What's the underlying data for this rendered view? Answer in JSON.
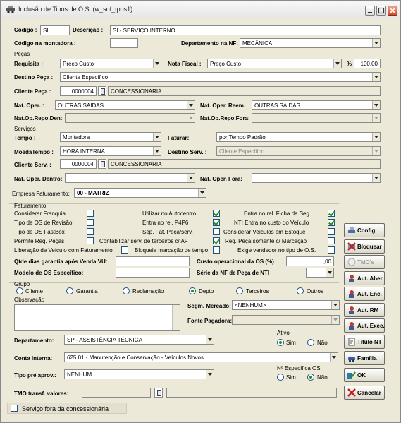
{
  "window": {
    "title": "Inclusão de Tipos de O.S. (w_sof_tpos1)"
  },
  "header": {
    "codigo_label": "Código :",
    "codigo_value": "SI",
    "descricao_label": "Descrição :",
    "descricao_value": "SI - SERVIÇO INTERNO",
    "codigo_montadora_label": "Código na montadora :",
    "codigo_montadora_value": "",
    "departamento_nf_label": "Departamento na NF:",
    "departamento_nf_value": "MECÂNICA"
  },
  "pecas": {
    "section_label": "Peças",
    "requisita_label": "Requisita :",
    "requisita_value": "Preço Custo",
    "nota_fiscal_label": "Nota Fiscal :",
    "nota_fiscal_value": "Preço Custo",
    "percent_label": "%",
    "percent_value": "100,00",
    "destino_label": "Destino Peça :",
    "destino_value": "Cliente Específico",
    "cliente_label": "Cliente Peça :",
    "cliente_code": "0000004",
    "cliente_name": "CONCESSIONARIA",
    "nat_oper_label": "Nat. Oper. :",
    "nat_oper_value": "OUTRAS SAIDAS",
    "nat_oper_reem_label": "Nat. Oper. Reem.",
    "nat_oper_reem_value": "OUTRAS SAIDAS",
    "nat_repo_den_label": "Nat.Op.Repo.Den:",
    "nat_repo_den_value": "",
    "nat_repo_fora_label": "Nat.Op.Repo.Fora:",
    "nat_repo_fora_value": ""
  },
  "servicos": {
    "section_label": "Serviços",
    "tempo_label": "Tempo :",
    "tempo_value": "Montadora",
    "faturar_label": "Faturar:",
    "faturar_value": "por Tempo Padrão",
    "moeda_label": "MoedaTempo :",
    "moeda_value": "HORA  INTERNA",
    "destino_label": "Destino Serv. :",
    "destino_value": "Cliente Específico",
    "cliente_label": "Cliente Serv. :",
    "cliente_code": "0000004",
    "cliente_name": "CONCESSIONARIA",
    "nat_dentro_label": "Nat. Oper. Dentro:",
    "nat_dentro_value": "",
    "nat_fora_label": "Nat. Oper. Fora:",
    "nat_fora_value": ""
  },
  "empresa": {
    "label": "Empresa Faturamento:",
    "value": "00 - MATRIZ"
  },
  "faturamento": {
    "section_label": "Faturamento",
    "checks": [
      {
        "label": "Considerar Franquia",
        "checked": false
      },
      {
        "label": "Tipo de OS de Revisão",
        "checked": false
      },
      {
        "label": "Tipo de OS FastBox",
        "checked": false
      },
      {
        "label": "Permite Req. Peças",
        "checked": false
      },
      {
        "label": "Liberação de Veículo com Faturamento",
        "checked": false
      },
      {
        "label": "Utilizar no Autocentro",
        "checked": true
      },
      {
        "label": "Entra no rel. P4P6",
        "checked": true
      },
      {
        "label": "Sep. Fat. Peça/serv.",
        "checked": false
      },
      {
        "label": "Contabilizar serv. de terceiros c/ AF",
        "checked": true
      },
      {
        "label": "Bloqueia marcação de tempo",
        "checked": false
      },
      {
        "label": "Entra no rel. Ficha de Seg.",
        "checked": true
      },
      {
        "label": "NTI Entra no custo do Veículo",
        "checked": true
      },
      {
        "label": "Considerar Veículos em Estoque",
        "checked": false
      },
      {
        "label": "Req. Peça somente c/ Marcação",
        "checked": false
      },
      {
        "label": "Exige vendedor no tipo de O.S.",
        "checked": false
      }
    ],
    "qtde_label": "Qtde dias garantia após Venda VU:",
    "qtde_value": "",
    "custo_label": "Custo operacional da OS (%)",
    "custo_value": ",00",
    "modelo_label": "Modelo de OS Específico:",
    "modelo_value": "",
    "serie_label": "Série da NF de Peça de NTI",
    "serie_value": ""
  },
  "grupo": {
    "section_label": "Grupo",
    "options": [
      {
        "label": "Cliente",
        "selected": false
      },
      {
        "label": "Garantia",
        "selected": false
      },
      {
        "label": "Reclamação",
        "selected": false
      },
      {
        "label": "Depto",
        "selected": true
      },
      {
        "label": "Terceiros",
        "selected": false
      },
      {
        "label": "Outros",
        "selected": false
      }
    ],
    "observacao_label": "Observação",
    "segm_label": "Segm. Mercado:",
    "segm_value": "<NENHUM>",
    "fonte_label": "Fonte Pagadora:",
    "fonte_value": ""
  },
  "bottom": {
    "departamento_label": "Departamento:",
    "departamento_value": "SP - ASSISTÊNCIA TÉCNICA",
    "ativo_label": "Ativo",
    "ativo_sim": "Sim",
    "ativo_nao": "Não",
    "conta_label": "Conta Interna:",
    "conta_value": "625.01 - Manutenção e Conservação - Veículos Novos",
    "tipo_pre_label": "Tipo pré aprov.:",
    "tipo_pre_value": "NENHUM",
    "nespecifica_label": "Nº Específica OS",
    "nespecifica_sim": "Sim",
    "nespecifica_nao": "Não",
    "tmo_label": "TMO transf. valores:",
    "tmo_value": "",
    "tmo_name": "",
    "servico_fora_label": "Serviço fora da concessionária"
  },
  "buttons": [
    {
      "label": "Config.",
      "icon": "tools-icon",
      "enabled": true
    },
    {
      "label": "Bloquear",
      "icon": "block-icon",
      "enabled": true
    },
    {
      "label": "TMO's",
      "icon": "clock-icon",
      "enabled": false
    },
    {
      "label": "Aut. Aber.",
      "icon": "person-icon",
      "enabled": true
    },
    {
      "label": "Aut. Enc.",
      "icon": "person-icon",
      "enabled": true
    },
    {
      "label": "Aut. RM",
      "icon": "person-icon",
      "enabled": true
    },
    {
      "label": "Aut. Exec.",
      "icon": "person-icon",
      "enabled": true
    },
    {
      "label": "Título NT",
      "icon": "document-icon",
      "enabled": true
    },
    {
      "label": "Família",
      "icon": "car-icon",
      "enabled": true
    },
    {
      "label": "OK",
      "icon": "ok-icon",
      "enabled": true
    },
    {
      "label": "Cancelar",
      "icon": "cancel-icon",
      "enabled": true
    }
  ]
}
